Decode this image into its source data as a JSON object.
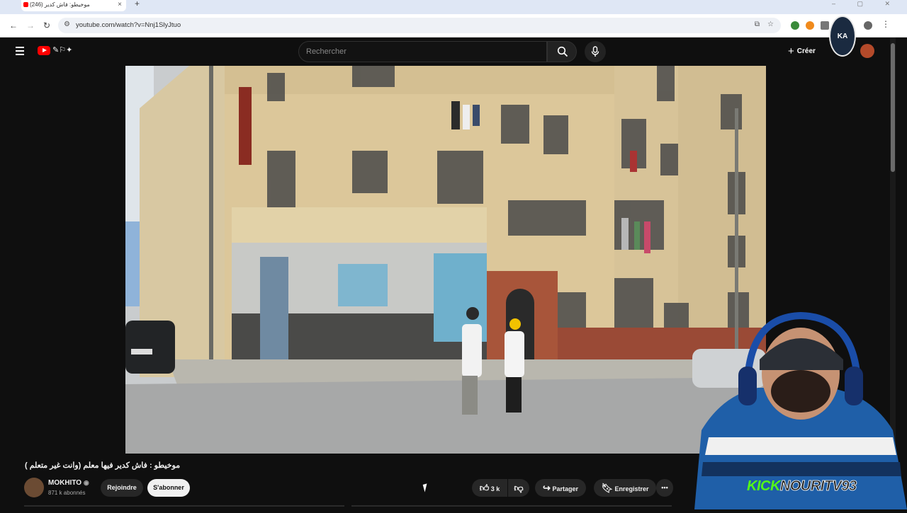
{
  "browser": {
    "tab_title": "موخيطو: فاش كدير (246)",
    "url": "youtube.com/watch?v=Nnj1SlyJtuo"
  },
  "youtube": {
    "search_placeholder": "Rechercher",
    "create_label": "Créer",
    "icons": [
      "menu-icon",
      "youtube-logo",
      "search-icon",
      "mic-icon",
      "create-icon"
    ]
  },
  "video": {
    "title": "موخيطو : فاش كدير فيها معلم (وانت غير متعلم )",
    "channel": "MOKHITO",
    "subscribers": "871 k abonnés",
    "join_label": "Rejoindre",
    "subscribe_label": "S'abonner",
    "likes": "3 k",
    "share_label": "Partager",
    "save_label": "Enregistrer"
  },
  "overlay": {
    "emblem_text": "KA",
    "streamer_tag_kick": "KICK",
    "streamer_tag_name": "NOURITV93"
  },
  "colors": {
    "background": "#0f0f0f",
    "youtube_red": "#ff0000",
    "kick_green": "#53fc18"
  }
}
